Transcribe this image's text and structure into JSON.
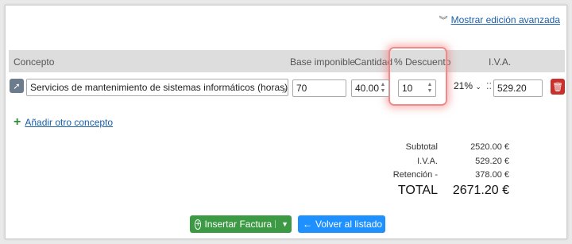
{
  "toolbar": {
    "advanced_label": "Mostrar edición avanzada"
  },
  "table": {
    "headers": {
      "concepto": "Concepto",
      "base": "Base imponible",
      "cantidad": "Cantidad",
      "descuento": "% Descuento",
      "iva": "I.V.A."
    },
    "row": {
      "concepto": "Servicios de mantenimiento de sistemas informáticos (horas)",
      "base": "70",
      "cantidad": "40.00",
      "descuento": "10",
      "iva_rate": "21%",
      "iva_amount": "529.20"
    }
  },
  "add_concept_label": "Añadir otro concepto",
  "totals": {
    "subtotal_label": "Subtotal",
    "subtotal_value": "2520.00 €",
    "iva_label": "I.V.A.",
    "iva_value": "529.20 €",
    "retencion_label": "Retención -",
    "retencion_value": "378.00 €",
    "total_label": "TOTAL",
    "total_value": "2671.20 €"
  },
  "buttons": {
    "insert_label": "Insertar Factura",
    "back_label": "Volver al listado"
  },
  "colors": {
    "insert_button": "#3c9a45",
    "back_button": "#1e90ff",
    "delete_button": "#c9302c",
    "link": "#1a5fa8",
    "focus_highlight": "#f08a8a"
  }
}
